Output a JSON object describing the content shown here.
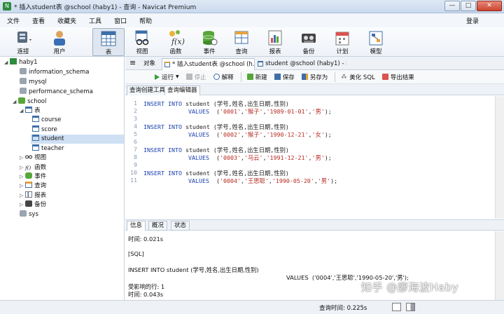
{
  "window": {
    "title": "* 插入student表 @school (haby1) - 查询 - Navicat Premium",
    "min": "—",
    "max": "□",
    "close": "✕"
  },
  "menu": {
    "items": [
      "文件",
      "查看",
      "收藏夹",
      "工具",
      "窗口",
      "帮助"
    ],
    "login": "登录"
  },
  "toolbar": {
    "connect": "连接",
    "user": "用户",
    "table": "表",
    "view": "视图",
    "function": "函数",
    "event": "事件",
    "query": "查询",
    "report": "报表",
    "backup": "备份",
    "schedule": "计划",
    "model": "模型"
  },
  "sidebar": {
    "connection": "haby1",
    "dbs": [
      "information_schema",
      "mysql",
      "performance_schema",
      "school"
    ],
    "tables_node": "表",
    "tables": [
      "course",
      "score",
      "student",
      "teacher"
    ],
    "nodes": [
      "视图",
      "函数",
      "事件",
      "查询",
      "报表",
      "备份"
    ],
    "sys": "sys"
  },
  "tabs": {
    "objects": "对象",
    "active": "* 插入student表 @school (h...",
    "other": "student @school (haby1) - 表"
  },
  "qtoolbar": {
    "run": "运行",
    "stop": "停止",
    "explain": "解释",
    "new": "新建",
    "save": "保存",
    "saveas": "另存为",
    "beautify": "美化 SQL",
    "export": "导出结果"
  },
  "subtabs": {
    "builder": "查询创建工具",
    "editor": "查询编辑器"
  },
  "code": {
    "insert": "INSERT INTO",
    "table": "student",
    "cols": "(学号,姓名,出生日期,性别)",
    "values": "VALUES",
    "rows": [
      [
        "'0001'",
        "'猴子'",
        "'1989-01-01'",
        "'男'"
      ],
      [
        "'0002'",
        "'猴子'",
        "'1990-12-21'",
        "'女'"
      ],
      [
        "'0003'",
        "'马云'",
        "'1991-12-21'",
        "'男'"
      ],
      [
        "'0004'",
        "'王思聪'",
        "'1990-05-20'",
        "'男'"
      ]
    ]
  },
  "panel": {
    "tabs": [
      "信息",
      "概况",
      "状态"
    ]
  },
  "messages": {
    "time1": "时间: 0.021s",
    "sql": "[SQL]",
    "insert": "INSERT INTO student (学号,姓名,出生日期,性别)",
    "values": "VALUES  ('0004','王思聪','1990-05-20','男');",
    "affected": "受影响的行: 1",
    "time2": "时间: 0.043s"
  },
  "status": {
    "query_time": "查询时间: 0.225s"
  },
  "watermark": "知乎 @廖海波Haby",
  "colors": {
    "keyword": "#1a3fb0",
    "string": "#b52a1f",
    "linenum": "#8a9bb0"
  }
}
